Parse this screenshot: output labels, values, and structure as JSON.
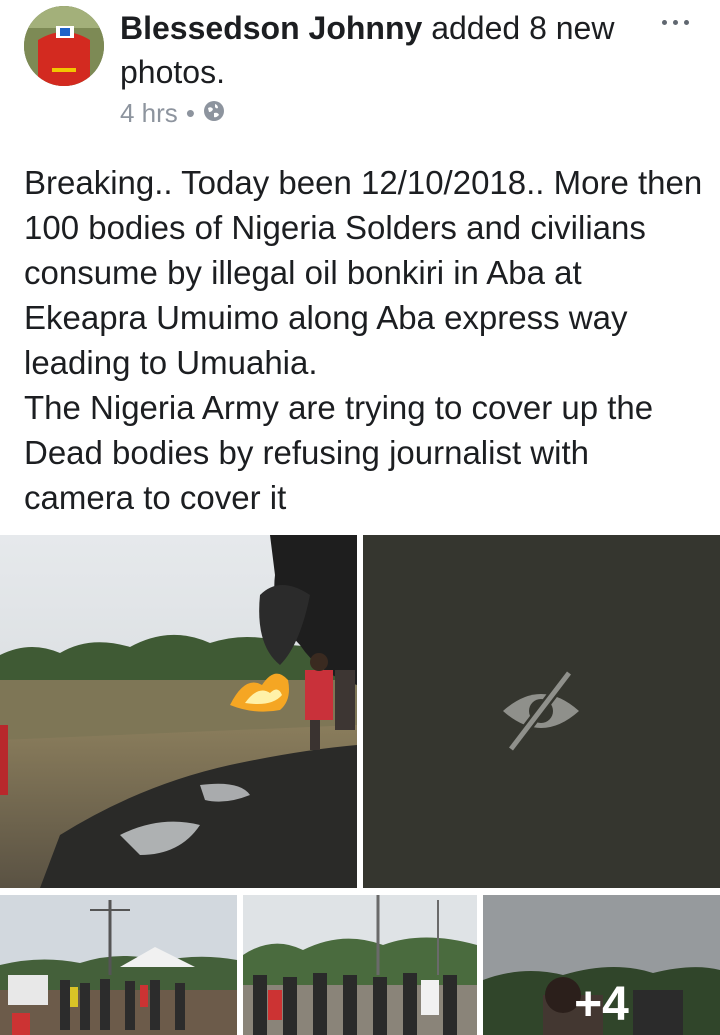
{
  "post": {
    "author": "Blessedson Johnny",
    "action": "added 8 new photos.",
    "time": "4 hrs",
    "separator": "•",
    "privacy_icon": "globe-icon",
    "more_icon": "ellipsis-icon",
    "text_lines": [
      "Breaking.. Today been 12/10/2018.. More then 100 bodies of Nigeria Solders and civilians consume by illegal oil bonkiri in Aba at Ekeapra Umuimo along Aba express way leading to Umuahia.",
      "The Nigeria Army are trying to cover up the Dead bodies by refusing journalist with camera to cover it"
    ]
  },
  "photos": {
    "hidden_icon": "eye-slash-icon",
    "more_count": "+4",
    "colors": {
      "fire": "#f5a623",
      "smoke": "#1e1e1e",
      "hidden_bg": "#35362f",
      "sky": "#d9dde2"
    }
  }
}
